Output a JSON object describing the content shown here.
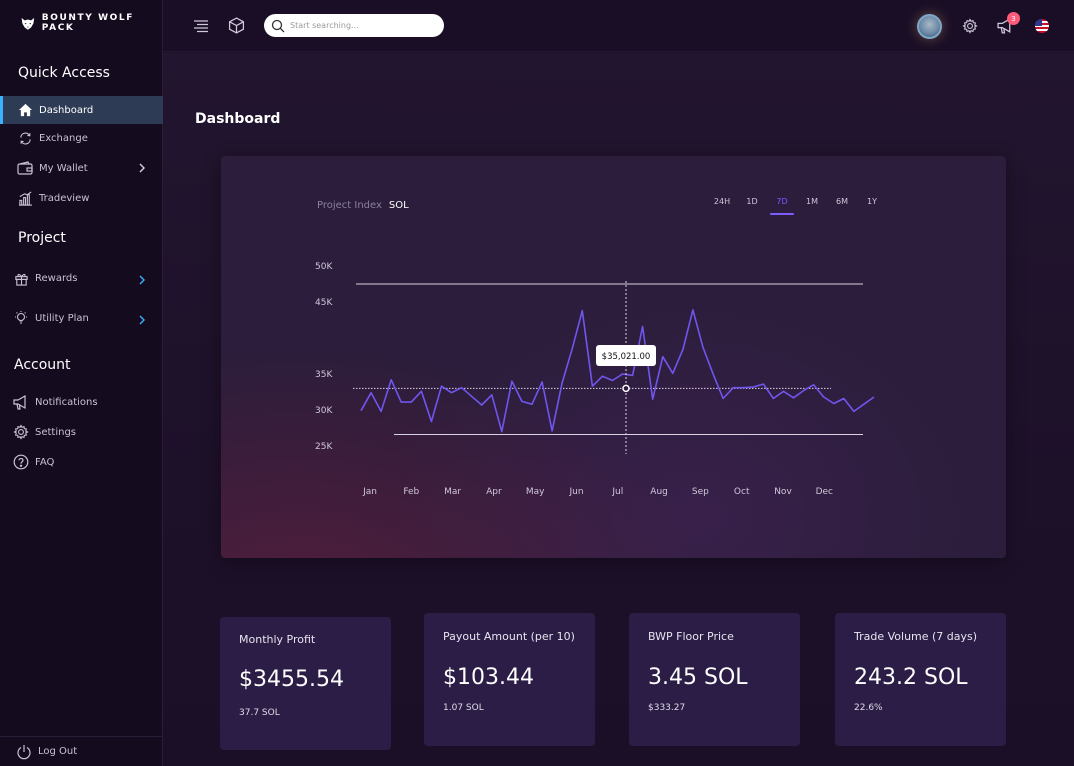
{
  "brand": {
    "name": "BOUNTY WOLF PACK"
  },
  "sidebar": {
    "quick_access_title": "Quick Access",
    "quick_items": [
      {
        "label": "Dashboard",
        "icon": "home-icon",
        "active": true
      },
      {
        "label": "Exchange",
        "icon": "exchange-icon"
      },
      {
        "label": "My Wallet",
        "icon": "wallet-icon",
        "has_chevron": true
      },
      {
        "label": "Tradeview",
        "icon": "bar-chart-icon"
      }
    ],
    "project_title": "Project",
    "project_items": [
      {
        "label": "Rewards",
        "icon": "gift-icon",
        "has_chevron": true
      },
      {
        "label": "Utility Plan",
        "icon": "lightbulb-icon",
        "has_chevron": true
      }
    ],
    "account_title": "Account",
    "account_items": [
      {
        "label": "Notifications",
        "icon": "megaphone-icon"
      },
      {
        "label": "Settings",
        "icon": "gear-icon"
      },
      {
        "label": "FAQ",
        "icon": "question-icon"
      }
    ],
    "logout_label": "Log Out"
  },
  "topbar": {
    "search_placeholder": "Start searching...",
    "notification_count": "3"
  },
  "main": {
    "page_title": "Dashboard"
  },
  "chart_card": {
    "label": "Project Index",
    "unit": "SOL",
    "ranges": [
      "24H",
      "1D",
      "7D",
      "1M",
      "6M",
      "1Y"
    ],
    "active_range": "7D",
    "tooltip": "$35,021.00"
  },
  "chart_data": {
    "type": "line",
    "title": "",
    "xlabel": "",
    "ylabel": "",
    "ylim": [
      25000,
      50000
    ],
    "y_ticks": [
      "50K",
      "45K",
      "35K",
      "30K",
      "25K"
    ],
    "y_tick_values": [
      50000,
      45000,
      35000,
      30000,
      25000
    ],
    "month_labels": [
      "Jan",
      "Feb",
      "Mar",
      "Apr",
      "May",
      "Jun",
      "Jul",
      "Aug",
      "Sep",
      "Oct",
      "Nov",
      "Dec"
    ],
    "series": [
      {
        "values": [
          29900,
          32400,
          29800,
          34200,
          31100,
          31100,
          32600,
          28400,
          33300,
          32400,
          33100,
          31900,
          30700,
          32100,
          27000,
          34000,
          31200,
          30800,
          33900,
          27100,
          33800,
          38500,
          43800,
          33300,
          34700,
          34100,
          35000,
          34800,
          41600,
          31500,
          37400,
          35100,
          38400,
          43900,
          38700,
          35000,
          31600,
          33100,
          33100,
          33200,
          33600,
          31600,
          32600,
          31700,
          32700,
          33500,
          31800,
          30900,
          31600,
          29800,
          30800,
          31800
        ]
      }
    ],
    "highlight": {
      "value": 35021,
      "label": "$35,021.00"
    },
    "reference_lines": [
      47500,
      26600
    ],
    "crosshair_value": 33000,
    "grid": false
  },
  "stats": [
    {
      "title": "Monthly Profit",
      "value": "$3455.54",
      "sub": "37.7 SOL"
    },
    {
      "title": "Payout Amount (per 10)",
      "value": "$103.44",
      "sub": "1.07 SOL"
    },
    {
      "title": "BWP Floor Price",
      "value": "3.45 SOL",
      "sub": "$333.27"
    },
    {
      "title": "Trade Volume (7 days)",
      "value": "243.2 SOL",
      "sub": "22.6%"
    }
  ],
  "colors": {
    "accent": "#7a5cff",
    "line": "#6f56ee",
    "active_nav_border": "#3ab3ff",
    "badge": "#ff5a78"
  }
}
